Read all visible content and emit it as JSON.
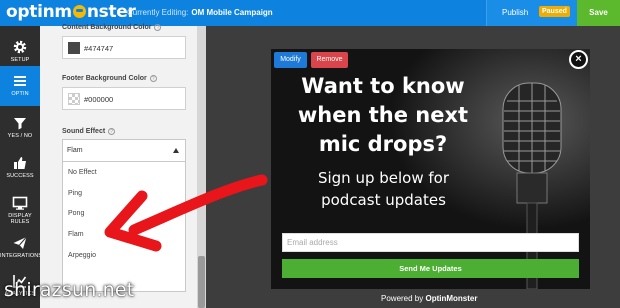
{
  "header": {
    "logo_text_pre": "optinm",
    "logo_text_post": "nster",
    "editing_label": "Currently Editing:",
    "campaign_name": "OM Mobile Campaign",
    "publish_label": "Publish",
    "status_badge": "Paused",
    "save_label": "Save"
  },
  "nav": {
    "items": [
      {
        "label": "Setup",
        "icon": "gear-icon"
      },
      {
        "label": "Optin",
        "icon": "menu-icon"
      },
      {
        "label": "Yes / No",
        "icon": "filter-icon"
      },
      {
        "label": "Success",
        "icon": "thumbs-up-icon"
      },
      {
        "label": "Display Rules",
        "icon": "monitor-icon"
      },
      {
        "label": "Integrations",
        "icon": "paper-plane-icon"
      },
      {
        "label": "Analytics",
        "icon": "chart-icon"
      }
    ],
    "active": "Optin"
  },
  "settings": {
    "content_bg_label": "Content Background Color",
    "content_bg_value": "#474747",
    "footer_bg_label": "Footer Background Color",
    "footer_bg_value": "#000000",
    "sound_effect_label": "Sound Effect",
    "sound_effect_value": "Flam",
    "sound_effect_options": [
      "No Effect",
      "Ping",
      "Pong",
      "Flam",
      "Arpeggio"
    ]
  },
  "popup": {
    "modify_label": "Modify",
    "remove_label": "Remove",
    "close_label": "×",
    "headline": "Want to know when the next mic drops?",
    "subline": "Sign up below for podcast updates",
    "email_placeholder": "Email address",
    "submit_label": "Send Me Updates",
    "powered_prefix": "Powered by",
    "powered_brand": "OptinMonster"
  },
  "watermark": "shirazsun.net",
  "colors": {
    "topbar": "#0d82df",
    "save": "#5cb82d",
    "badge": "#f0ad00",
    "submit": "#4caf33",
    "remove": "#d9454a",
    "arrow": "#e8151b"
  }
}
